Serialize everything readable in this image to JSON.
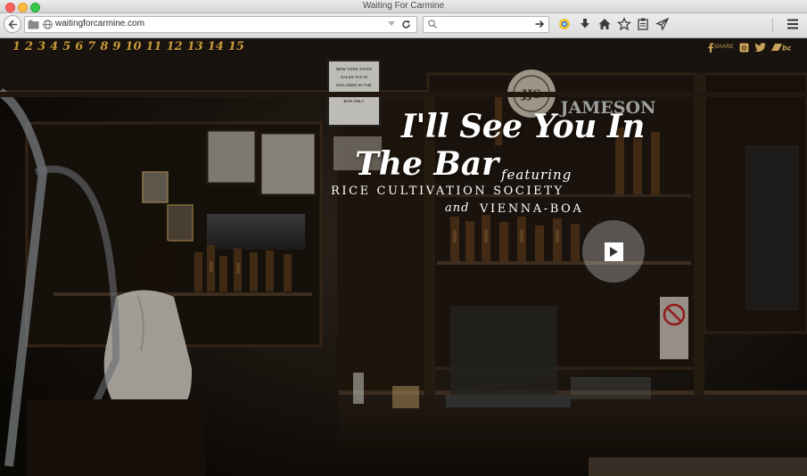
{
  "window": {
    "title": "Waiting For Carmine"
  },
  "toolbar": {
    "url": "waitingforcarmine.com",
    "search_placeholder": ""
  },
  "page": {
    "chapters": [
      "1",
      "2",
      "3",
      "4",
      "5",
      "6",
      "7",
      "8",
      "9",
      "10",
      "11",
      "12",
      "13",
      "14",
      "15"
    ],
    "social": {
      "share_label": "SHARE",
      "icons": [
        "facebook-icon",
        "instagram-icon",
        "twitter-icon",
        "bandcamp-icon"
      ]
    },
    "headline": {
      "line1": "I'll See You In",
      "line2": "The Bar",
      "featuring": "featuring",
      "artist1": "RICE CULTIVATION SOCIETY",
      "and": "and",
      "artist2": "VIENNA-BOA"
    },
    "bar_sign": "NEW YORK STATE SALES TAX IS INCLUDED IN THE DRINKS AT THIS BAR ONLY",
    "jameson_label": "JAMESON"
  },
  "colors": {
    "chapter_gold": "#c89b3a",
    "overlay_white": "#ffffff",
    "accent_gold": "#c9a25a"
  }
}
